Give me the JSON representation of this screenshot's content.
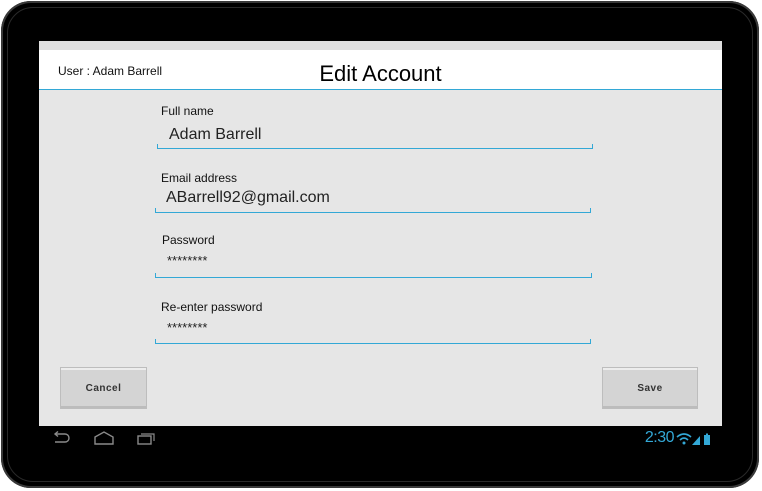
{
  "header": {
    "user_label": "User : Adam Barrell",
    "title": "Edit Account"
  },
  "form": {
    "full_name": {
      "label": "Full name",
      "value": "Adam Barrell"
    },
    "email": {
      "label": "Email address",
      "value": "ABarrell92@gmail.com"
    },
    "password": {
      "label": "Password",
      "value": "********"
    },
    "reenter_password": {
      "label": "Re-enter password",
      "value": "********"
    }
  },
  "buttons": {
    "cancel_label": "Cancel",
    "save_label": "Save"
  },
  "status_bar": {
    "time": "2:30",
    "accent_color": "#33a8d6"
  },
  "icons": [
    "back-icon",
    "home-icon",
    "recent-apps-icon",
    "wifi-icon",
    "signal-icon",
    "battery-icon"
  ]
}
